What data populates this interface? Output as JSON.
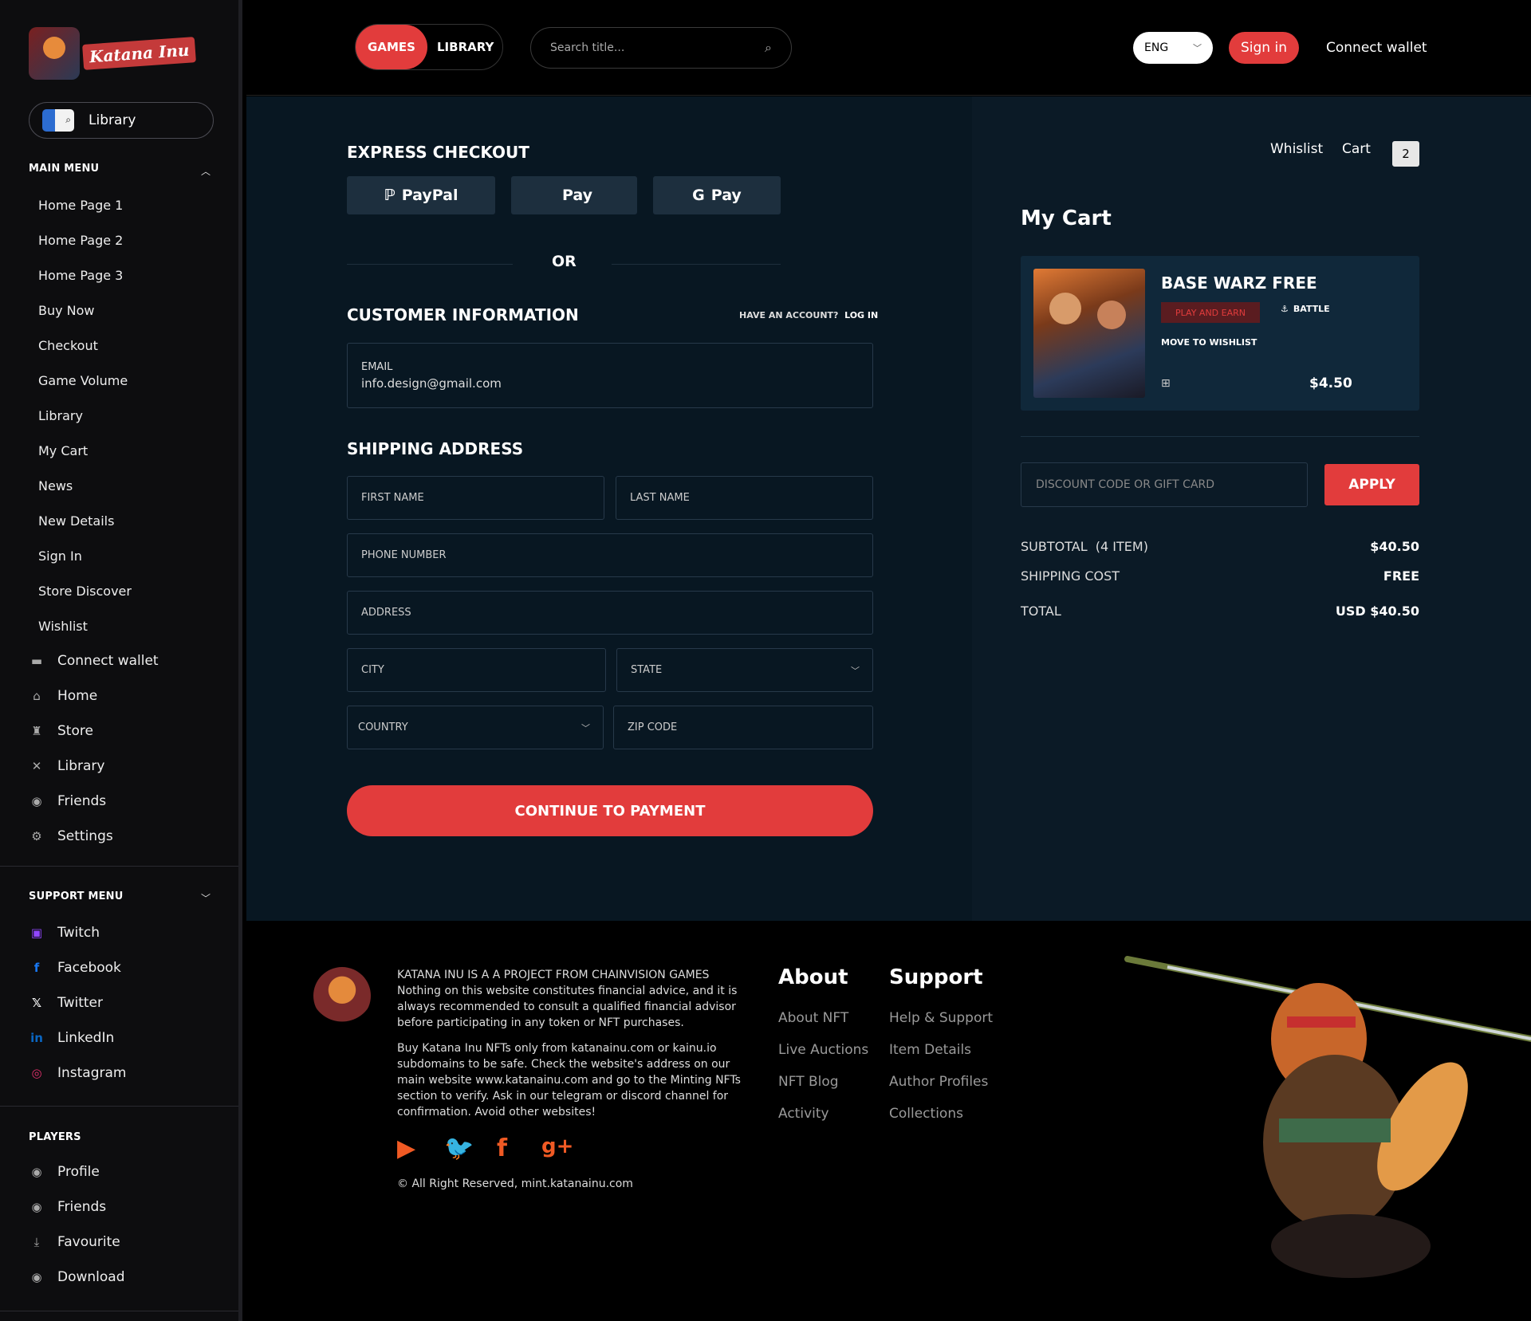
{
  "brand": {
    "logo_text": "Katana Inu"
  },
  "sidebar": {
    "library_pill": "Library",
    "main_menu_title": "MAIN MENU",
    "main_items": [
      "Home Page 1",
      "Home Page 2",
      "Home Page 3",
      "Buy Now",
      "Checkout",
      "Game Volume",
      "Library",
      "My Cart",
      "News",
      "New Details",
      "Sign In",
      "Store Discover",
      "Wishlist"
    ],
    "icon_items": [
      {
        "label": "Connect wallet",
        "icon": "wallet-icon",
        "glyph": "▬"
      },
      {
        "label": "Home",
        "icon": "home-icon",
        "glyph": "⌂"
      },
      {
        "label": "Store",
        "icon": "store-icon",
        "glyph": "♜"
      },
      {
        "label": "Library",
        "icon": "library-icon",
        "glyph": "✕"
      },
      {
        "label": "Friends",
        "icon": "friends-icon",
        "glyph": "◉"
      },
      {
        "label": "Settings",
        "icon": "settings-icon",
        "glyph": "⚙"
      }
    ],
    "support_menu_title": "SUPPORT MENU",
    "support_items": [
      {
        "label": "Twitch",
        "icon": "twitch-icon",
        "glyph": "▣",
        "color": "#9146ff"
      },
      {
        "label": "Facebook",
        "icon": "facebook-icon",
        "glyph": "f",
        "color": "#1877f2"
      },
      {
        "label": "Twitter",
        "icon": "x-twitter-icon",
        "glyph": "𝕏",
        "color": "#ffffff"
      },
      {
        "label": "LinkedIn",
        "icon": "linkedin-icon",
        "glyph": "in",
        "color": "#0a66c2"
      },
      {
        "label": "Instagram",
        "icon": "instagram-icon",
        "glyph": "◎",
        "color": "#e1306c"
      }
    ],
    "players_title": "PLAYERS",
    "player_items": [
      {
        "label": "Profile",
        "icon": "profile-icon",
        "glyph": "◉"
      },
      {
        "label": "Friends",
        "icon": "friends-icon",
        "glyph": "◉"
      },
      {
        "label": "Favourite",
        "icon": "favourite-icon",
        "glyph": "⤓"
      },
      {
        "label": "Download",
        "icon": "download-icon",
        "glyph": "◉"
      }
    ]
  },
  "topbar": {
    "tab_games": "GAMES",
    "tab_library": "LIBRARY",
    "search_placeholder": "Search title...",
    "lang": "ENG",
    "signin": "Sign in",
    "connect_wallet": "Connect wallet"
  },
  "checkout": {
    "express_title": "EXPRESS CHECKOUT",
    "paypal": "PayPal",
    "apple_pay": "Pay",
    "google_pay": "Pay",
    "or": "OR",
    "customer_title": "CUSTOMER INFORMATION",
    "have_account": "HAVE AN ACCOUNT?",
    "log_in": "LOG IN",
    "email_label": "EMAIL",
    "email_value": "info.design@gmail.com",
    "shipping_title": "SHIPPING ADDRESS",
    "first_name": "FIRST NAME",
    "last_name": "LAST NAME",
    "phone": "PHONE NUMBER",
    "address": "ADDRESS",
    "city": "CITY",
    "state": "STATE",
    "country": "COUNTRY",
    "zip": "ZIP CODE",
    "continue": "CONTINUE TO PAYMENT"
  },
  "cart": {
    "wishlist_link": "Whislist",
    "cart_link": "Cart",
    "cart_count": "2",
    "title": "My Cart",
    "item": {
      "name": "BASE WARZ FREE",
      "tag": "PLAY AND EARN",
      "genre": "BATTLE",
      "move": "MOVE TO WISHLIST",
      "price": "$4.50"
    },
    "discount_placeholder": "DISCOUNT CODE OR GIFT CARD",
    "apply": "APPLY",
    "subtotal_label": "SUBTOTAL",
    "subtotal_items": "(4 ITEM)",
    "subtotal_value": "$40.50",
    "shipping_label": "SHIPPING COST",
    "shipping_value": "FREE",
    "total_label": "TOTAL",
    "total_value": "USD $40.50"
  },
  "footer": {
    "para1": "KATANA INU IS A A PROJECT FROM CHAINVISION GAMES Nothing on this website constitutes financial advice, and it is always recommended to consult a qualified financial advisor before participating in any token or NFT purchases.",
    "para2": "Buy Katana Inu NFTs only from katanainu.com or kainu.io subdomains to be safe. Check the website's address on our main website www.katanainu.com and go to the Minting NFTs section to verify. Ask in our telegram or discord channel for confirmation. Avoid other websites!",
    "about_title": "About",
    "about_links": [
      "About NFT",
      "Live Auctions",
      "NFT Blog",
      "Activity"
    ],
    "support_title": "Support",
    "support_links": [
      "Help & Support",
      "Item Details",
      "Author Profiles",
      "Collections"
    ],
    "copyright": "© All Right Reserved, mint.katanainu.com"
  },
  "colors": {
    "accent": "#e23c3c",
    "panel": "#081722",
    "card": "#10283a",
    "social": "#f05a24"
  }
}
